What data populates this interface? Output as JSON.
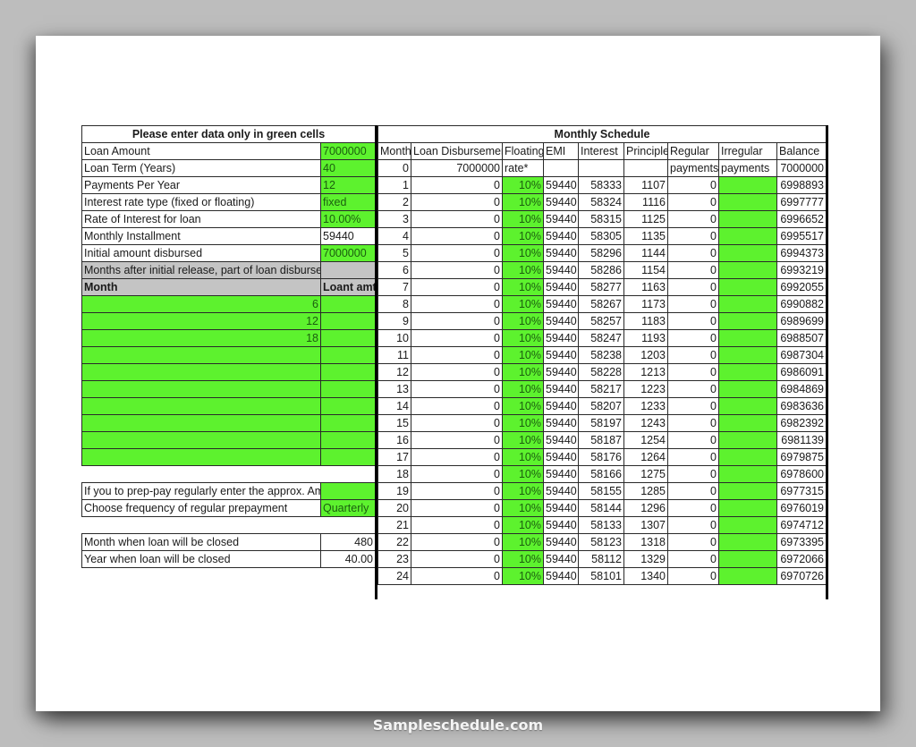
{
  "footer": {
    "watermark": "Sampleschedule.com"
  },
  "left": {
    "title": "Please enter data only in green cells",
    "inputs": [
      {
        "label": "Loan Amount",
        "value": "7000000",
        "editable": true
      },
      {
        "label": "Loan Term (Years)",
        "value": "40",
        "editable": true
      },
      {
        "label": "Payments Per Year",
        "value": "12",
        "editable": true
      },
      {
        "label": "Interest rate type (fixed or floating)",
        "value": "fixed",
        "editable": true
      },
      {
        "label": "Rate of Interest for loan",
        "value": "10.00%",
        "editable": true
      },
      {
        "label": "Monthly Installment",
        "value": "59440",
        "editable": false
      },
      {
        "label": "Initial amount disbursed",
        "value": "7000000",
        "editable": true
      }
    ],
    "disbursement_section_label": "Months after initial release, part of loan disbursed",
    "disbursement_headers": {
      "month": "Month",
      "amount": "Loant amt"
    },
    "disbursements": [
      {
        "month": "6",
        "amount": ""
      },
      {
        "month": "12",
        "amount": ""
      },
      {
        "month": "18",
        "amount": ""
      },
      {
        "month": "",
        "amount": ""
      },
      {
        "month": "",
        "amount": ""
      },
      {
        "month": "",
        "amount": ""
      },
      {
        "month": "",
        "amount": ""
      },
      {
        "month": "",
        "amount": ""
      },
      {
        "month": "",
        "amount": ""
      },
      {
        "month": "",
        "amount": ""
      }
    ],
    "prepay_amount_label": "If you to prep-pay regularly enter the approx. Amt",
    "prepay_amount_value": "",
    "prepay_frequency_label": "Choose frequency of regular prepayment",
    "prepay_frequency_value": "Quarterly",
    "close_month_label": "Month when loan will be closed",
    "close_month_value": "480",
    "close_year_label": "Year when loan will be closed",
    "close_year_value": "40.00"
  },
  "schedule": {
    "title": "Monthly Schedule",
    "headers": [
      "Month",
      "Loan Disbursement",
      "Floating",
      "EMI",
      "Interest",
      "Principle",
      "Regular",
      "Irregular",
      "Balance"
    ],
    "row0": {
      "month": "0",
      "disbursement": "7000000",
      "floating": "rate*",
      "emi": "",
      "interest": "",
      "principle": "",
      "regular": "payments",
      "irregular": "payments",
      "balance": "7000000"
    },
    "rows": [
      [
        "1",
        "0",
        "10%",
        "59440",
        "58333",
        "1107",
        "0",
        "",
        "6998893"
      ],
      [
        "2",
        "0",
        "10%",
        "59440",
        "58324",
        "1116",
        "0",
        "",
        "6997777"
      ],
      [
        "3",
        "0",
        "10%",
        "59440",
        "58315",
        "1125",
        "0",
        "",
        "6996652"
      ],
      [
        "4",
        "0",
        "10%",
        "59440",
        "58305",
        "1135",
        "0",
        "",
        "6995517"
      ],
      [
        "5",
        "0",
        "10%",
        "59440",
        "58296",
        "1144",
        "0",
        "",
        "6994373"
      ],
      [
        "6",
        "0",
        "10%",
        "59440",
        "58286",
        "1154",
        "0",
        "",
        "6993219"
      ],
      [
        "7",
        "0",
        "10%",
        "59440",
        "58277",
        "1163",
        "0",
        "",
        "6992055"
      ],
      [
        "8",
        "0",
        "10%",
        "59440",
        "58267",
        "1173",
        "0",
        "",
        "6990882"
      ],
      [
        "9",
        "0",
        "10%",
        "59440",
        "58257",
        "1183",
        "0",
        "",
        "6989699"
      ],
      [
        "10",
        "0",
        "10%",
        "59440",
        "58247",
        "1193",
        "0",
        "",
        "6988507"
      ],
      [
        "11",
        "0",
        "10%",
        "59440",
        "58238",
        "1203",
        "0",
        "",
        "6987304"
      ],
      [
        "12",
        "0",
        "10%",
        "59440",
        "58228",
        "1213",
        "0",
        "",
        "6986091"
      ],
      [
        "13",
        "0",
        "10%",
        "59440",
        "58217",
        "1223",
        "0",
        "",
        "6984869"
      ],
      [
        "14",
        "0",
        "10%",
        "59440",
        "58207",
        "1233",
        "0",
        "",
        "6983636"
      ],
      [
        "15",
        "0",
        "10%",
        "59440",
        "58197",
        "1243",
        "0",
        "",
        "6982392"
      ],
      [
        "16",
        "0",
        "10%",
        "59440",
        "58187",
        "1254",
        "0",
        "",
        "6981139"
      ],
      [
        "17",
        "0",
        "10%",
        "59440",
        "58176",
        "1264",
        "0",
        "",
        "6979875"
      ],
      [
        "18",
        "0",
        "10%",
        "59440",
        "58166",
        "1275",
        "0",
        "",
        "6978600"
      ],
      [
        "19",
        "0",
        "10%",
        "59440",
        "58155",
        "1285",
        "0",
        "",
        "6977315"
      ],
      [
        "20",
        "0",
        "10%",
        "59440",
        "58144",
        "1296",
        "0",
        "",
        "6976019"
      ],
      [
        "21",
        "0",
        "10%",
        "59440",
        "58133",
        "1307",
        "0",
        "",
        "6974712"
      ],
      [
        "22",
        "0",
        "10%",
        "59440",
        "58123",
        "1318",
        "0",
        "",
        "6973395"
      ],
      [
        "23",
        "0",
        "10%",
        "59440",
        "58112",
        "1329",
        "0",
        "",
        "6972066"
      ],
      [
        "24",
        "0",
        "10%",
        "59440",
        "58101",
        "1340",
        "0",
        "",
        "6970726"
      ]
    ]
  },
  "colors": {
    "input_green": "#5df22e",
    "header_gray": "#c4c4c4"
  }
}
